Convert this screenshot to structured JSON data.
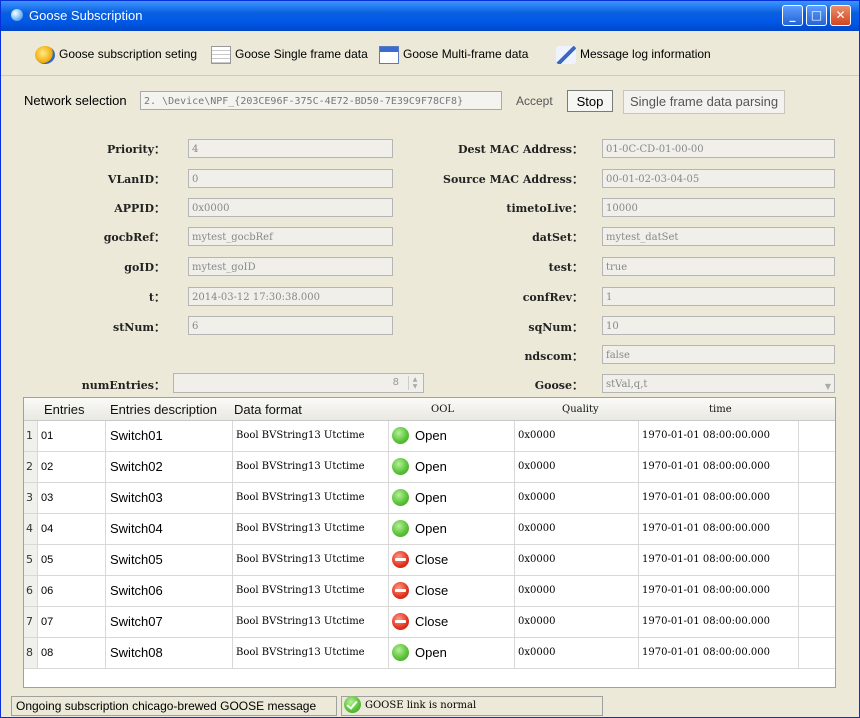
{
  "window": {
    "title": "Goose Subscription",
    "min_glyph": "_",
    "max_glyph": "□",
    "close_glyph": "✕"
  },
  "toolbar": {
    "items": [
      {
        "label": "Goose subscription seting",
        "icon": "subscription-icon"
      },
      {
        "label": "Goose Single frame data",
        "icon": "single-frame-icon"
      },
      {
        "label": "Goose Multi-frame data",
        "icon": "multi-frame-icon"
      },
      {
        "label": "Message log information",
        "icon": "message-log-icon"
      }
    ]
  },
  "network": {
    "label": "Network selection",
    "value": "2.  \\Device\\NPF_{203CE96F-375C-4E72-BD50-7E39C9F78CF8}",
    "accept": "Accept",
    "stop": "Stop",
    "parse": "Single frame data parsing"
  },
  "fields": {
    "priority": {
      "label": "Priority：",
      "value": "4"
    },
    "vlanid": {
      "label": "VLanID：",
      "value": "0"
    },
    "appid": {
      "label": "APPID：",
      "value": "0x0000"
    },
    "gocbref": {
      "label": "gocbRef：",
      "value": "mytest_gocbRef"
    },
    "goid": {
      "label": "goID：",
      "value": "mytest_goID"
    },
    "t": {
      "label": "t：",
      "value": "2014-03-12 17:30:38.000"
    },
    "stnum": {
      "label": "stNum：",
      "value": "6"
    },
    "numentries": {
      "label": "numEntries：",
      "value": "8"
    },
    "destmac": {
      "label": "Dest MAC Address：",
      "value": "01-0C-CD-01-00-00"
    },
    "srcmac": {
      "label": "Source MAC Address：",
      "value": "00-01-02-03-04-05"
    },
    "ttl": {
      "label": "timetoLive：",
      "value": "10000"
    },
    "datset": {
      "label": "datSet：",
      "value": "mytest_datSet"
    },
    "test": {
      "label": "test：",
      "value": "true"
    },
    "confrev": {
      "label": "confRev：",
      "value": "1"
    },
    "sqnum": {
      "label": "sqNum：",
      "value": "10"
    },
    "ndscom": {
      "label": "ndscom：",
      "value": "false"
    },
    "goose": {
      "label": "Goose：",
      "value": "stVal,q,t"
    }
  },
  "table": {
    "headers": [
      "Entries",
      "Entries description",
      "Data format",
      "OOL",
      "Quality",
      "time"
    ],
    "rows": [
      {
        "n": "1",
        "entry": "01",
        "desc": "Switch01",
        "format": "Bool BVString13 Utctime",
        "ool": "Open",
        "quality": "0x0000",
        "time": "1970-01-01 08:00:00.000"
      },
      {
        "n": "2",
        "entry": "02",
        "desc": "Switch02",
        "format": "Bool BVString13 Utctime",
        "ool": "Open",
        "quality": "0x0000",
        "time": "1970-01-01 08:00:00.000"
      },
      {
        "n": "3",
        "entry": "03",
        "desc": "Switch03",
        "format": "Bool BVString13 Utctime",
        "ool": "Open",
        "quality": "0x0000",
        "time": "1970-01-01 08:00:00.000"
      },
      {
        "n": "4",
        "entry": "04",
        "desc": "Switch04",
        "format": "Bool BVString13 Utctime",
        "ool": "Open",
        "quality": "0x0000",
        "time": "1970-01-01 08:00:00.000"
      },
      {
        "n": "5",
        "entry": "05",
        "desc": "Switch05",
        "format": "Bool BVString13 Utctime",
        "ool": "Close",
        "quality": "0x0000",
        "time": "1970-01-01 08:00:00.000"
      },
      {
        "n": "6",
        "entry": "06",
        "desc": "Switch06",
        "format": "Bool BVString13 Utctime",
        "ool": "Close",
        "quality": "0x0000",
        "time": "1970-01-01 08:00:00.000"
      },
      {
        "n": "7",
        "entry": "07",
        "desc": "Switch07",
        "format": "Bool BVString13 Utctime",
        "ool": "Close",
        "quality": "0x0000",
        "time": "1970-01-01 08:00:00.000"
      },
      {
        "n": "8",
        "entry": "08",
        "desc": "Switch08",
        "format": "Bool BVString13 Utctime",
        "ool": "Open",
        "quality": "0x0000",
        "time": "1970-01-01 08:00:00.000"
      }
    ]
  },
  "status": {
    "left": "Ongoing subscription chicago-brewed GOOSE message",
    "right": "GOOSE link is normal"
  },
  "colors": {
    "title_bar": "#0058e6",
    "open": "#5cc33a",
    "close": "#e0321c",
    "window_bg": "#ece9d8"
  }
}
